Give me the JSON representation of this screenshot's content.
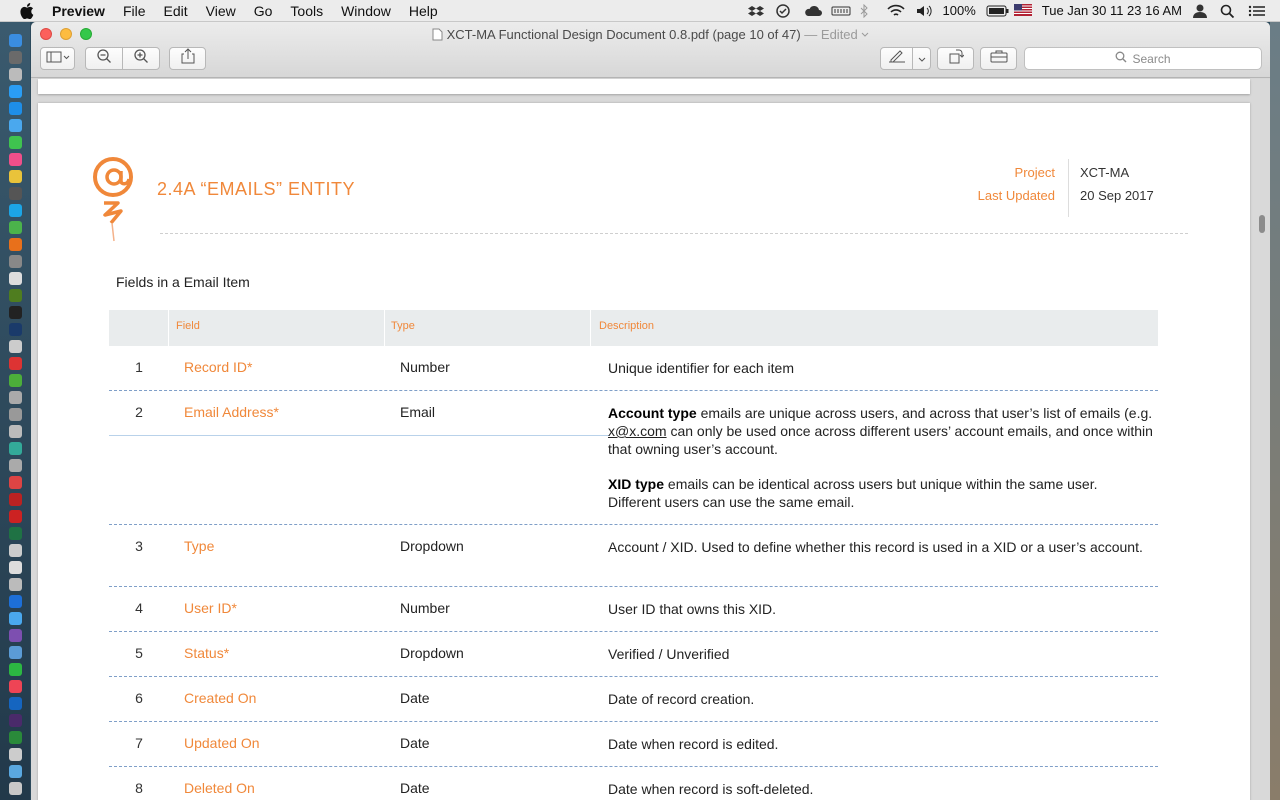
{
  "menubar": {
    "app_name": "Preview",
    "items": [
      "File",
      "Edit",
      "View",
      "Go",
      "Tools",
      "Window",
      "Help"
    ],
    "battery": "100%",
    "datetime": "Tue Jan 30  11 23 16 AM"
  },
  "window": {
    "doc_title": "XCT-MA Functional Design Document 0.8.pdf (page 10 of 47)",
    "edited": " — Edited",
    "search_placeholder": "Search"
  },
  "document": {
    "section_title": "2.4A “EMAILS” ENTITY",
    "meta": {
      "project_label": "Project",
      "project_value": "XCT-MA",
      "updated_label": "Last Updated",
      "updated_value": "20 Sep 2017"
    },
    "table_caption": "Fields in a Email Item",
    "table": {
      "headers": {
        "field": "Field",
        "type": "Type",
        "description": "Description"
      },
      "rows": [
        {
          "num": "1",
          "field": "Record ID*",
          "type": "Number",
          "desc": "Unique identifier for each item"
        },
        {
          "num": "2",
          "field": "Email Address*",
          "type": "Email",
          "desc_a_bold": "Account type",
          "desc_a_1": " emails are unique across users, and across that user’s list of emails (e.g. ",
          "desc_a_link": "x@x.com",
          "desc_a_2": " can only be used once across different users’ account emails, and once within that owning user’s account.",
          "desc_b_bold": "XID type",
          "desc_b": " emails can be identical across users but unique within the same user.  Different users can use the same email."
        },
        {
          "num": "3",
          "field": "Type",
          "type": "Dropdown",
          "desc": "Account / XID. Used to define whether this record is used in a XID or a user’s account."
        },
        {
          "num": "4",
          "field": "User ID*",
          "type": "Number",
          "desc": "User ID that owns this XID."
        },
        {
          "num": "5",
          "field": "Status*",
          "type": "Dropdown",
          "desc": "Verified / Unverified"
        },
        {
          "num": "6",
          "field": "Created On",
          "type": "Date",
          "desc": "Date of record creation."
        },
        {
          "num": "7",
          "field": "Updated On",
          "type": "Date",
          "desc": "Date when record is edited."
        },
        {
          "num": "8",
          "field": "Deleted On",
          "type": "Date",
          "desc": "Date when record is soft-deleted."
        }
      ]
    }
  },
  "colors": {
    "accent": "#f0883a",
    "row_rule": "#7f9fc8",
    "header_bg": "#e9eced"
  }
}
